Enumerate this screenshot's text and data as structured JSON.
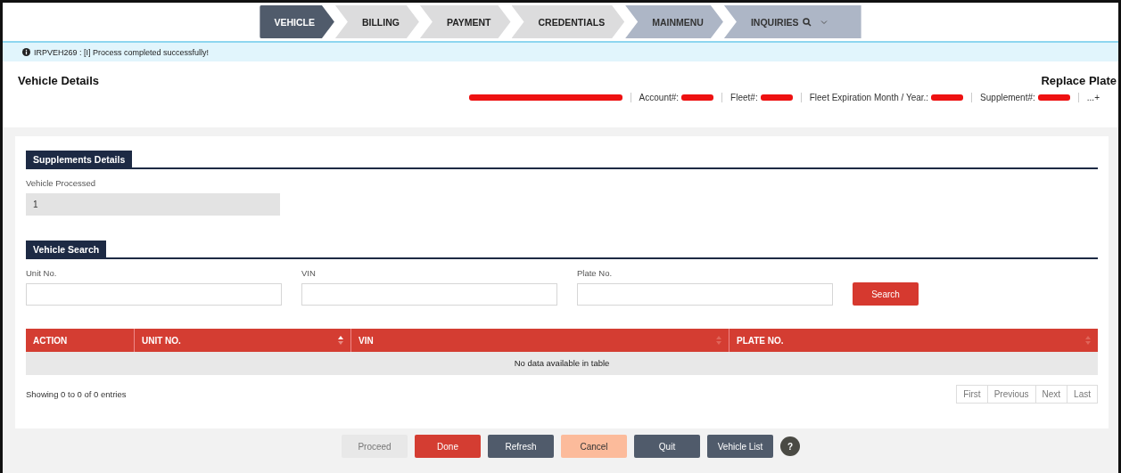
{
  "steps": [
    {
      "label": "VEHICLE",
      "kind": "current"
    },
    {
      "label": "BILLING",
      "kind": "pending"
    },
    {
      "label": "PAYMENT",
      "kind": "pending"
    },
    {
      "label": "CREDENTIALS",
      "kind": "pending"
    },
    {
      "label": "MAINMENU",
      "kind": "menu"
    },
    {
      "label": "INQUIRIES",
      "kind": "menu-search"
    }
  ],
  "message": "IRPVEH269 : [I] Process completed successfully!",
  "header": {
    "title": "Vehicle Details",
    "action": "Replace Plate",
    "info": [
      {
        "redacted": true
      },
      {
        "label": "Account#:",
        "redacted": true
      },
      {
        "label": "Fleet#:",
        "redacted": true
      },
      {
        "label": "Fleet Expiration Month / Year.:",
        "redacted": true
      },
      {
        "label": "Supplement#:",
        "redacted": true
      },
      {
        "label": "...+",
        "redacted": false
      }
    ]
  },
  "supplements": {
    "title": "Supplements Details",
    "field_label": "Vehicle Processed",
    "value": "1"
  },
  "search": {
    "title": "Vehicle Search",
    "fields": [
      {
        "label": "Unit No."
      },
      {
        "label": "VIN"
      },
      {
        "label": "Plate No."
      }
    ],
    "button": "Search"
  },
  "table": {
    "columns": [
      {
        "label": "ACTION",
        "sortable": false,
        "sorted": false
      },
      {
        "label": "UNIT NO.",
        "sortable": true,
        "sorted": true
      },
      {
        "label": "VIN",
        "sortable": true,
        "sorted": false
      },
      {
        "label": "PLATE NO.",
        "sortable": true,
        "sorted": false
      }
    ],
    "empty": "No data available in table",
    "info": "Showing 0 to 0 of 0 entries",
    "pager": [
      {
        "label": "First",
        "disabled": true
      },
      {
        "label": "Previous",
        "disabled": true
      },
      {
        "label": "Next",
        "disabled": true
      },
      {
        "label": "Last",
        "disabled": true
      }
    ]
  },
  "buttons": [
    {
      "label": "Proceed",
      "kind": "disabled"
    },
    {
      "label": "Done",
      "kind": "primary"
    },
    {
      "label": "Refresh",
      "kind": "secondary"
    },
    {
      "label": "Cancel",
      "kind": "warning"
    },
    {
      "label": "Quit",
      "kind": "secondary"
    },
    {
      "label": "Vehicle List",
      "kind": "secondary"
    }
  ],
  "help": "?"
}
